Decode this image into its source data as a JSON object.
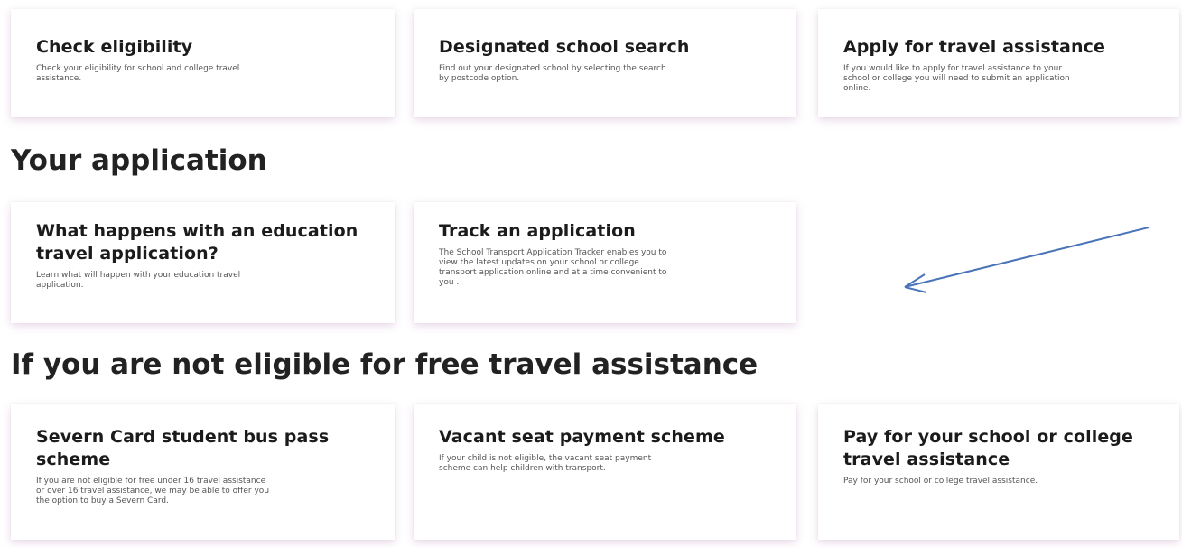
{
  "row1": {
    "cards": [
      {
        "title": "Check eligibility",
        "desc": "Check your eligibility for school and college travel assistance."
      },
      {
        "title": "Designated school search",
        "desc": "Find out your designated school by selecting the search by postcode option."
      },
      {
        "title": "Apply for travel assistance",
        "desc": "If you would like to apply for travel assistance to your school or college you will need to submit an application online."
      }
    ]
  },
  "your_application": {
    "heading": "Your application",
    "cards": [
      {
        "title": "What happens with an education travel application?",
        "desc": "Learn what will happen with your education travel application."
      },
      {
        "title": "Track an application",
        "desc": "The School Transport Application Tracker enables you to view the latest updates on your school or college transport application online and at a time convenient to you ."
      }
    ]
  },
  "not_eligible": {
    "heading": "If you are not eligible for free travel assistance",
    "cards": [
      {
        "title": "Severn Card student bus pass scheme",
        "desc": "If you are not eligible for free under 16 travel assistance or over 16 travel assistance, we may be able to offer you the option to buy a Severn Card."
      },
      {
        "title": "Vacant seat payment scheme",
        "desc": "If your child is not eligible, the vacant seat payment scheme can help children with transport."
      },
      {
        "title": "Pay for your school or college travel assistance",
        "desc": "Pay for your school or college travel assistance."
      }
    ]
  },
  "annotation": {
    "arrow_color": "#4a74b8",
    "icon": "arrow-icon"
  }
}
